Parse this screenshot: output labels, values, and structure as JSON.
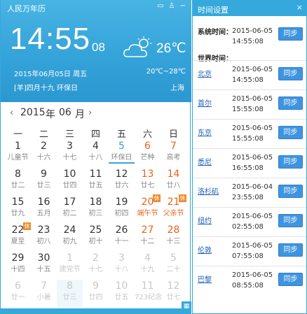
{
  "app": {
    "title": "人民万年历"
  },
  "header": {
    "time_hm": "14:55",
    "time_s": "08",
    "temperature": "26℃",
    "date_line": "2015年06月05日  周五",
    "temp_range": "20℃~28℃",
    "lunar_line": "[羊]四月十九 环保日",
    "city": "上海"
  },
  "nav": {
    "prev": "‹",
    "year": "2015",
    "year_unit": "年",
    "month": "06",
    "month_unit": "月",
    "next": "›"
  },
  "weekdays": [
    "一",
    "二",
    "三",
    "四",
    "五",
    "六",
    "日"
  ],
  "days": [
    {
      "n": "1",
      "s": "儿童节",
      "nc": "dark",
      "sc": "gray"
    },
    {
      "n": "2",
      "s": "十六",
      "nc": "dark",
      "sc": "gray"
    },
    {
      "n": "3",
      "s": "十七",
      "nc": "dark",
      "sc": "gray"
    },
    {
      "n": "4",
      "s": "十八",
      "nc": "dark",
      "sc": "gray"
    },
    {
      "n": "5",
      "s": "环保日",
      "nc": "blue",
      "sc": "gray",
      "today": true
    },
    {
      "n": "6",
      "s": "芒种",
      "nc": "red",
      "sc": "gray"
    },
    {
      "n": "7",
      "s": "高考",
      "nc": "red",
      "sc": "gray"
    },
    {
      "n": "8",
      "s": "廿二",
      "nc": "dark",
      "sc": "gray"
    },
    {
      "n": "9",
      "s": "廿三",
      "nc": "dark",
      "sc": "gray"
    },
    {
      "n": "10",
      "s": "廿四",
      "nc": "dark",
      "sc": "gray"
    },
    {
      "n": "11",
      "s": "廿五",
      "nc": "dark",
      "sc": "gray"
    },
    {
      "n": "12",
      "s": "廿六",
      "nc": "dark",
      "sc": "gray"
    },
    {
      "n": "13",
      "s": "廿七",
      "nc": "red",
      "sc": "gray"
    },
    {
      "n": "14",
      "s": "廿八",
      "nc": "red",
      "sc": "gray"
    },
    {
      "n": "15",
      "s": "廿九",
      "nc": "dark",
      "sc": "gray"
    },
    {
      "n": "16",
      "s": "五月",
      "nc": "dark",
      "sc": "gray"
    },
    {
      "n": "17",
      "s": "初二",
      "nc": "dark",
      "sc": "gray"
    },
    {
      "n": "18",
      "s": "初三",
      "nc": "dark",
      "sc": "gray"
    },
    {
      "n": "19",
      "s": "初四",
      "nc": "dark",
      "sc": "gray"
    },
    {
      "n": "20",
      "s": "端午节",
      "nc": "red",
      "sc": "red",
      "badge": "休"
    },
    {
      "n": "21",
      "s": "父亲节",
      "nc": "red",
      "sc": "red",
      "badge": "休"
    },
    {
      "n": "22",
      "s": "夏至",
      "nc": "dark",
      "sc": "gray",
      "badge": "休"
    },
    {
      "n": "23",
      "s": "初八",
      "nc": "dark",
      "sc": "gray"
    },
    {
      "n": "24",
      "s": "初九",
      "nc": "dark",
      "sc": "gray"
    },
    {
      "n": "25",
      "s": "初十",
      "nc": "dark",
      "sc": "gray"
    },
    {
      "n": "26",
      "s": "十一",
      "nc": "dark",
      "sc": "gray"
    },
    {
      "n": "27",
      "s": "十二",
      "nc": "red",
      "sc": "gray"
    },
    {
      "n": "28",
      "s": "十三",
      "nc": "red",
      "sc": "gray"
    },
    {
      "n": "29",
      "s": "十四",
      "nc": "dark",
      "sc": "gray"
    },
    {
      "n": "30",
      "s": "十五",
      "nc": "dark",
      "sc": "gray"
    },
    {
      "n": "1",
      "s": "建党节",
      "nc": "light",
      "sc": "light"
    },
    {
      "n": "2",
      "s": "十七",
      "nc": "light",
      "sc": "light"
    },
    {
      "n": "3",
      "s": "十八",
      "nc": "light",
      "sc": "light"
    },
    {
      "n": "4",
      "s": "十九",
      "nc": "light",
      "sc": "light"
    },
    {
      "n": "5",
      "s": "二十",
      "nc": "light",
      "sc": "light"
    },
    {
      "n": "6",
      "s": "廿一",
      "nc": "light",
      "sc": "light"
    },
    {
      "n": "7",
      "s": "小暑",
      "nc": "light",
      "sc": "light"
    },
    {
      "n": "8",
      "s": "廿三",
      "nc": "light",
      "sc": "light",
      "sel": true
    },
    {
      "n": "9",
      "s": "廿四",
      "nc": "light",
      "sc": "light"
    },
    {
      "n": "10",
      "s": "廿五",
      "nc": "light",
      "sc": "light"
    },
    {
      "n": "11",
      "s": "723纪念",
      "nc": "light",
      "sc": "light"
    },
    {
      "n": "12",
      "s": "廿七",
      "nc": "light",
      "sc": "light"
    }
  ],
  "panel": {
    "title": "时间设置",
    "close": "×",
    "sys_label": "系统时间：",
    "sys_date": "2015-06-05",
    "sys_time": "14:55:08",
    "world_label": "世界时间：",
    "sync_label": "同步",
    "cities": [
      {
        "name": "北京",
        "date": "2015-06-05",
        "time": "14:55:08"
      },
      {
        "name": "首尔",
        "date": "2015-06-05",
        "time": "15:55:08"
      },
      {
        "name": "东京",
        "date": "2015-06-05",
        "time": "15:55:08"
      },
      {
        "name": "悉尼",
        "date": "2015-06-05",
        "time": "16:55:08"
      },
      {
        "name": "洛杉矶",
        "date": "2015-06-04",
        "time": "23:55:08"
      },
      {
        "name": "纽约",
        "date": "2015-06-05",
        "time": "02:55:08"
      },
      {
        "name": "伦敦",
        "date": "2015-06-05",
        "time": "07:55:08"
      },
      {
        "name": "巴黎",
        "date": "2015-06-05",
        "time": "08:55:08"
      }
    ]
  }
}
